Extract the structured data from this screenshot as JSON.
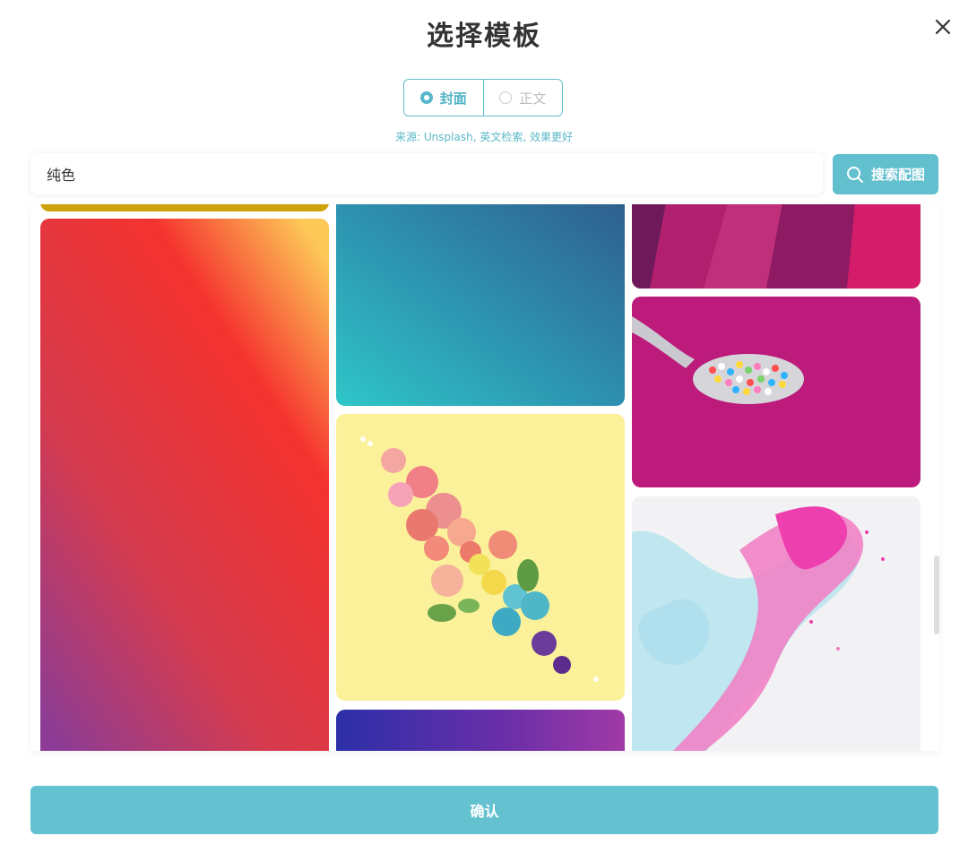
{
  "modal": {
    "title": "选择模板",
    "close_icon": "close-icon"
  },
  "mode_toggle": {
    "options": [
      {
        "label": "封面",
        "selected": true
      },
      {
        "label": "正文",
        "selected": false
      }
    ]
  },
  "source_hint": "来源: Unsplash, 英文检索, 效果更好",
  "search": {
    "value": "纯色",
    "button_label": "搜索配图",
    "button_icon": "search-icon"
  },
  "gallery": {
    "images": [
      {
        "subject": "mustard yellow solid strip"
      },
      {
        "subject": "orange red magenta purple gradient"
      },
      {
        "subject": "teal to blue gradient"
      },
      {
        "subject": "pink and magenta abstract panels"
      },
      {
        "subject": "spoon of colorful sprinkles on magenta"
      },
      {
        "subject": "flower arrangement on pale yellow"
      },
      {
        "subject": "pink and cyan fluid marble art"
      },
      {
        "subject": "indigo to purple gradient"
      }
    ]
  },
  "confirm": {
    "label": "确认"
  },
  "colors": {
    "accent": "#62bfce",
    "title": "#333333"
  }
}
